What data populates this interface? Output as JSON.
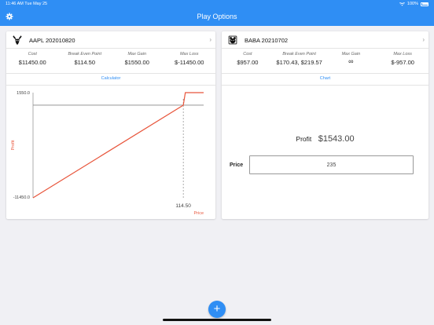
{
  "status": {
    "time": "11:46 AM",
    "date": "Tue May 25",
    "battery": "100%"
  },
  "header": {
    "title": "Play Options",
    "settings_icon": "gear-icon"
  },
  "colors": {
    "primary": "#2f8ef4",
    "payoff_line": "#e8553b",
    "breakeven_line": "#888888"
  },
  "left_card": {
    "title": "AAPL 202010820",
    "logo_icon": "bull-icon",
    "stats": [
      {
        "label": "Cost",
        "value": "$11450.00"
      },
      {
        "label": "Break Even Point",
        "value": "$114.50"
      },
      {
        "label": "Max Gain",
        "value": "$1550.00"
      },
      {
        "label": "Max Loss",
        "value": "$-11450.00"
      }
    ],
    "tab": "Calculator",
    "chart_data": {
      "type": "line",
      "x": [
        0,
        114.5,
        116.05,
        130
      ],
      "y": [
        -11450,
        0,
        1550,
        1550
      ],
      "ylim": [
        -11450,
        1550
      ],
      "y_ticks": [
        "1550.0",
        "-11450.0"
      ],
      "x_tick": "114.50",
      "ylabel": "Profit",
      "xlabel": "Price",
      "reference_line_y": 0,
      "reference_line_x": 114.5
    }
  },
  "right_card": {
    "title": "BABA 20210702",
    "logo_icon": "bear-icon",
    "stats": [
      {
        "label": "Cost",
        "value": "$957.00"
      },
      {
        "label": "Break Even Point",
        "value": "$170.43, $219.57"
      },
      {
        "label": "Max Gain",
        "value": "∞"
      },
      {
        "label": "Max Loss",
        "value": "$-957.00"
      }
    ],
    "tab": "Chart",
    "profit_label": "Profit",
    "profit_value": "$1543.00",
    "price_label": "Price",
    "price_value": "235"
  },
  "fab": {
    "label": "+"
  }
}
